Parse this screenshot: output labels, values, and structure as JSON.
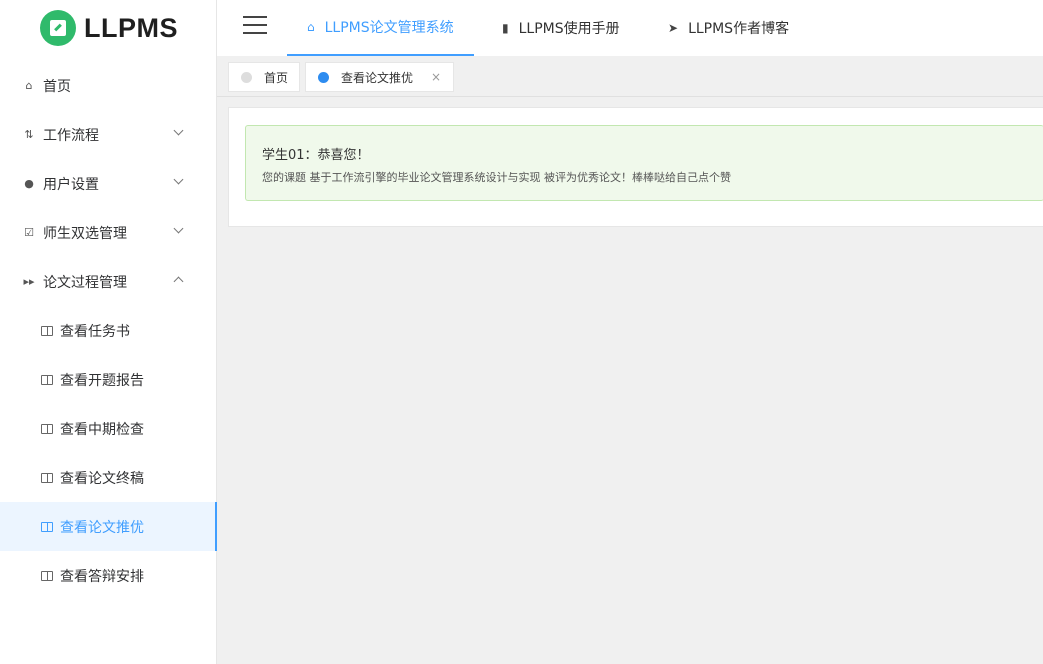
{
  "logo": {
    "text": "LLPMS"
  },
  "header": {
    "tabs": [
      {
        "label": "LLPMS论文管理系统",
        "icon": "home-icon"
      },
      {
        "label": "LLPMS使用手册",
        "icon": "document-icon"
      },
      {
        "label": "LLPMS作者博客",
        "icon": "send-icon"
      }
    ]
  },
  "sidebar": {
    "items": [
      {
        "label": "首页",
        "icon": "home-icon"
      },
      {
        "label": "工作流程",
        "icon": "workflow-icon"
      },
      {
        "label": "用户设置",
        "icon": "user-icon"
      },
      {
        "label": "师生双选管理",
        "icon": "checkbox-icon"
      },
      {
        "label": "论文过程管理",
        "icon": "forward-icon"
      }
    ],
    "subitems": [
      {
        "label": "查看任务书"
      },
      {
        "label": "查看开题报告"
      },
      {
        "label": "查看中期检查"
      },
      {
        "label": "查看论文终稿"
      },
      {
        "label": "查看论文推优"
      },
      {
        "label": "查看答辩安排"
      }
    ]
  },
  "tags": [
    {
      "label": "首页"
    },
    {
      "label": "查看论文推优",
      "close": "×"
    }
  ],
  "alert": {
    "title": "学生01：恭喜您！",
    "message": "您的课题 基于工作流引擎的毕业论文管理系统设计与实现 被评为优秀论文！棒棒哒给自己点个赞"
  },
  "colors": {
    "accent": "#409eff",
    "success_bg": "#f0f9eb",
    "logo": "#2fba6b"
  }
}
